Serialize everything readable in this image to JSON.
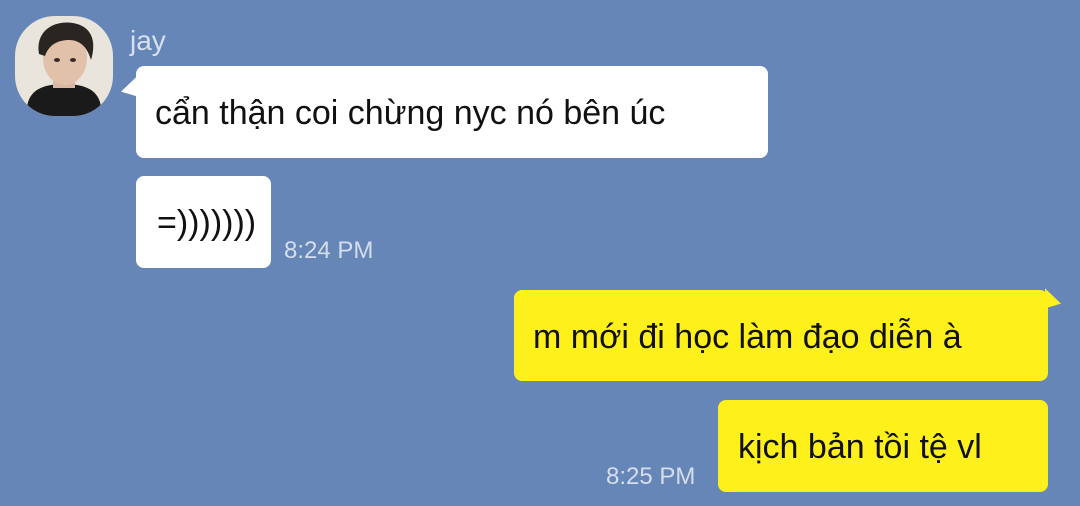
{
  "chat": {
    "sender_name": "jay",
    "messages": [
      {
        "direction": "incoming",
        "text": "cẩn thận coi chừng nyc nó bên úc"
      },
      {
        "direction": "incoming",
        "text": "=)))))))",
        "time": "8:24 PM"
      },
      {
        "direction": "outgoing",
        "text": "m mới đi học làm đạo diễn à"
      },
      {
        "direction": "outgoing",
        "text": "kịch bản tồi tệ vl",
        "time": "8:25 PM"
      }
    ]
  },
  "colors": {
    "background": "#6686b8",
    "incoming_bubble": "#ffffff",
    "outgoing_bubble": "#fef01b",
    "meta_text": "#d5deec"
  }
}
